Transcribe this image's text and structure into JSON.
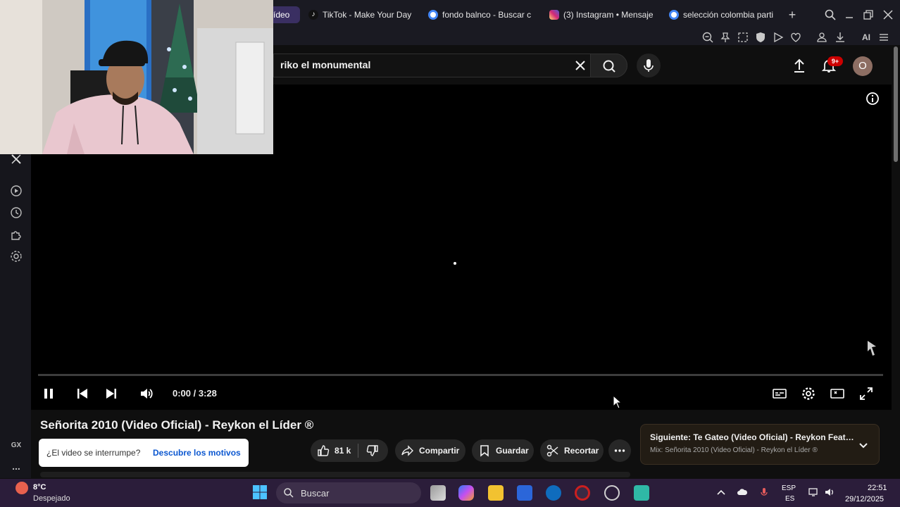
{
  "browser": {
    "tabs": [
      {
        "label": "ídeo",
        "active": true,
        "favicon_color": "#3a2f62"
      },
      {
        "label": "TikTok - Make Your Day",
        "active": false,
        "favicon_color": "#111111"
      },
      {
        "label": "fondo balnco - Buscar c",
        "active": false,
        "favicon_color": "#4285f4"
      },
      {
        "label": "(3) Instagram • Mensaje",
        "active": false,
        "favicon_color": "#d62976"
      },
      {
        "label": "selección colombia parti",
        "active": false,
        "favicon_color": "#4285f4"
      }
    ],
    "new_tab": "+",
    "toolbar_ai_label": "AI"
  },
  "youtube": {
    "search_value": "riko el monumental",
    "notifications_badge": "9+",
    "avatar_letter": "O",
    "player": {
      "time": "0:00 / 3:28",
      "progress_fraction": 0.0,
      "state": "playing"
    },
    "video_title": "Señorita 2010 (Video Oficial) - Reykon el Líder ®",
    "interrupt_prompt": {
      "question": "¿El video se interrumpe?",
      "link": "Descubre los motivos"
    },
    "actions": {
      "likes": "81 k",
      "share": "Compartir",
      "save": "Guardar",
      "clip": "Recortar"
    },
    "next_up": {
      "title": "Siguiente: Te Gateo (Video Oficial) - Reykon Feat. Pi...",
      "subtitle": "Mix: Señorita 2010 (Video Oficial) - Reykon el Líder ®"
    }
  },
  "sidebar": {
    "gx_label": "GX",
    "more_label": "..."
  },
  "taskbar": {
    "weather_temp": "8°C",
    "weather_desc": "Despejado",
    "search_label": "Buscar",
    "lang_top": "ESP",
    "lang_bottom": "ES",
    "time": "22:51",
    "date": "29/12/2025"
  },
  "colors": {
    "accent_opera": "#cc1f1f",
    "link_blue": "#0b57d0",
    "badge_red": "#cc0000"
  }
}
